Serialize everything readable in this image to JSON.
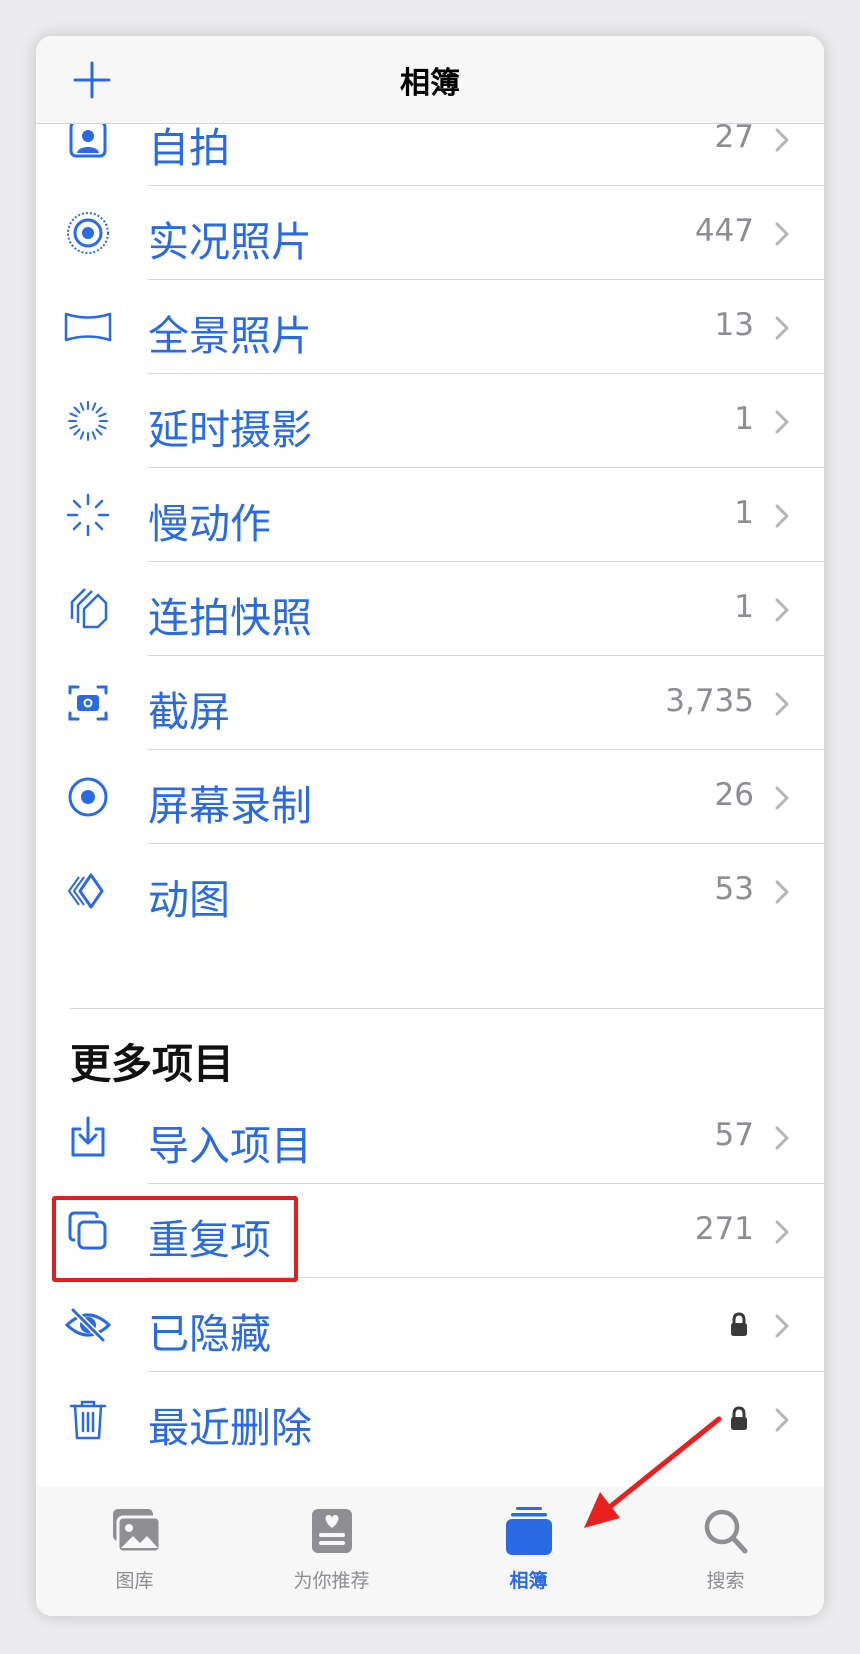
{
  "header": {
    "title": "相簿"
  },
  "colors": {
    "accent": "#2a6be3",
    "secondary": "#8d8d93",
    "highlight": "#e02020"
  },
  "media_types": [
    {
      "icon": "selfie-icon",
      "label": "自拍",
      "count": "27"
    },
    {
      "icon": "live-photo-icon",
      "label": "实况照片",
      "count": "447"
    },
    {
      "icon": "panorama-icon",
      "label": "全景照片",
      "count": "13"
    },
    {
      "icon": "timelapse-icon",
      "label": "延时摄影",
      "count": "1"
    },
    {
      "icon": "slow-motion-icon",
      "label": "慢动作",
      "count": "1"
    },
    {
      "icon": "burst-icon",
      "label": "连拍快照",
      "count": "1"
    },
    {
      "icon": "screenshot-icon",
      "label": "截屏",
      "count": "3,735"
    },
    {
      "icon": "screen-recording-icon",
      "label": "屏幕录制",
      "count": "26"
    },
    {
      "icon": "animated-icon",
      "label": "动图",
      "count": "53"
    }
  ],
  "more_section": {
    "title": "更多项目",
    "items": [
      {
        "icon": "import-icon",
        "label": "导入项目",
        "count": "57"
      },
      {
        "icon": "duplicates-icon",
        "label": "重复项",
        "count": "271"
      },
      {
        "icon": "hidden-icon",
        "label": "已隐藏",
        "locked": true
      },
      {
        "icon": "trash-icon",
        "label": "最近删除",
        "locked": true
      }
    ]
  },
  "tabbar": {
    "tabs": [
      {
        "icon": "library-icon",
        "label": "图库"
      },
      {
        "icon": "for-you-icon",
        "label": "为你推荐"
      },
      {
        "icon": "albums-icon",
        "label": "相簿",
        "active": true
      },
      {
        "icon": "search-icon",
        "label": "搜索"
      }
    ]
  }
}
